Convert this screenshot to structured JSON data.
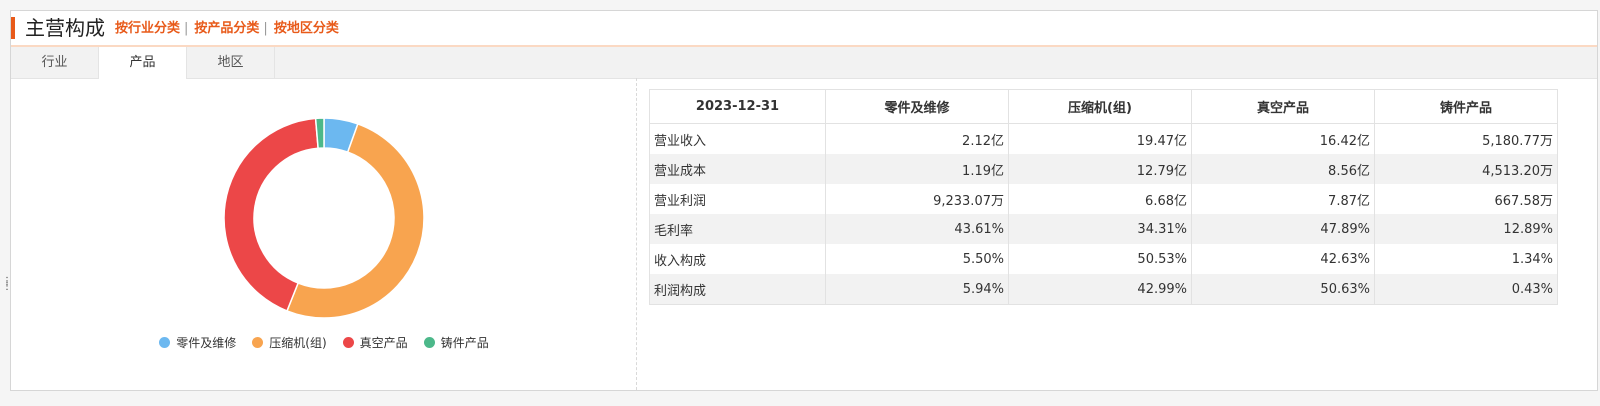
{
  "header": {
    "title": "主营构成",
    "links": [
      "按行业分类",
      "按产品分类",
      "按地区分类"
    ]
  },
  "tabs": [
    "行业",
    "产品",
    "地区"
  ],
  "active_tab": 1,
  "chart_data": {
    "type": "pie",
    "categories": [
      "零件及维修",
      "压缩机(组)",
      "真空产品",
      "铸件产品"
    ],
    "values": [
      5.5,
      50.53,
      42.63,
      1.34
    ],
    "colors": [
      "#6cb8f0",
      "#f8a44f",
      "#ec4748",
      "#4cb88a"
    ],
    "donut": true
  },
  "table": {
    "headers": [
      "2023-12-31",
      "零件及维修",
      "压缩机(组)",
      "真空产品",
      "铸件产品"
    ],
    "rows": [
      [
        "营业收入",
        "2.12亿",
        "19.47亿",
        "16.42亿",
        "5,180.77万"
      ],
      [
        "营业成本",
        "1.19亿",
        "12.79亿",
        "8.56亿",
        "4,513.20万"
      ],
      [
        "营业利润",
        "9,233.07万",
        "6.68亿",
        "7.87亿",
        "667.58万"
      ],
      [
        "毛利率",
        "43.61%",
        "34.31%",
        "47.89%",
        "12.89%"
      ],
      [
        "收入构成",
        "5.50%",
        "50.53%",
        "42.63%",
        "1.34%"
      ],
      [
        "利润构成",
        "5.94%",
        "42.99%",
        "50.63%",
        "0.43%"
      ]
    ]
  }
}
